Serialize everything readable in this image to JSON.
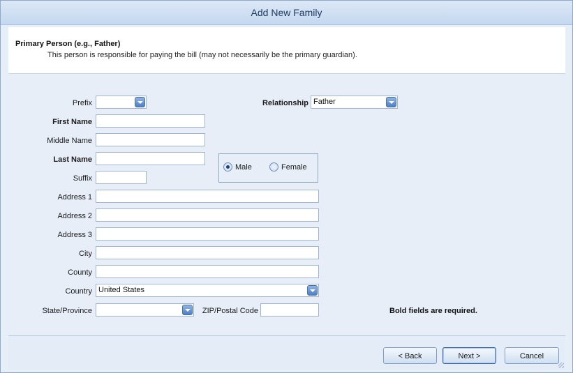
{
  "window": {
    "title": "Add New Family"
  },
  "header": {
    "title": "Primary Person (e.g., Father)",
    "description": "This person is responsible for paying the bill (may not necessarily be the primary guardian)."
  },
  "form": {
    "prefix": {
      "label": "Prefix",
      "value": ""
    },
    "relationship": {
      "label": "Relationship",
      "value": "Father"
    },
    "first_name": {
      "label": "First Name",
      "value": ""
    },
    "middle_name": {
      "label": "Middle Name",
      "value": ""
    },
    "last_name": {
      "label": "Last Name",
      "value": ""
    },
    "suffix": {
      "label": "Suffix",
      "value": ""
    },
    "gender": {
      "male_label": "Male",
      "female_label": "Female",
      "selected": "Male"
    },
    "address1": {
      "label": "Address 1",
      "value": ""
    },
    "address2": {
      "label": "Address 2",
      "value": ""
    },
    "address3": {
      "label": "Address 3",
      "value": ""
    },
    "city": {
      "label": "City",
      "value": ""
    },
    "county": {
      "label": "County",
      "value": ""
    },
    "country": {
      "label": "Country",
      "value": "United States"
    },
    "state": {
      "label": "State/Province",
      "value": ""
    },
    "zip": {
      "label": "ZIP/Postal Code",
      "value": ""
    },
    "required_note": "Bold fields are required."
  },
  "buttons": {
    "back": "< Back",
    "next": "Next >",
    "cancel": "Cancel"
  },
  "colors": {
    "accent": "#4d7fc6",
    "panel": "#e7eef8",
    "header_bg": "#ffffff"
  }
}
